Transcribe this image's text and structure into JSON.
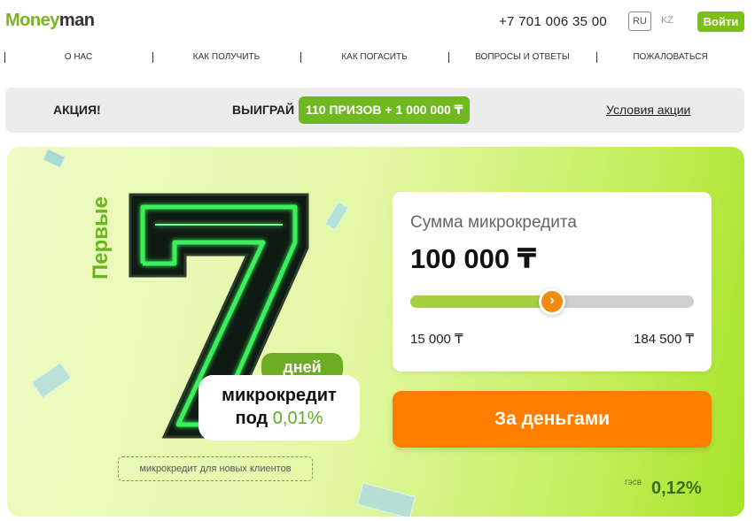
{
  "header": {
    "logo_part1": "Money",
    "logo_part2": "man",
    "phone": "+7 701 006 35 00",
    "lang_ru": "RU",
    "lang_kz": "KZ",
    "login_label": "Войти"
  },
  "nav": {
    "items": [
      {
        "label": "О НАС"
      },
      {
        "label": "КАК ПОЛУЧИТЬ"
      },
      {
        "label": "КАК ПОГАСИТЬ"
      },
      {
        "label": "ВОПРОСЫ И ОТВЕТЫ"
      },
      {
        "label": "ПОЖАЛОВАТЬСЯ"
      }
    ]
  },
  "promo": {
    "label": "АКЦИЯ!",
    "win": "ВЫИГРАЙ",
    "prize": "110 ПРИЗОВ + 1 000 000 ₸",
    "terms_link": "Условия акции"
  },
  "hero": {
    "first": "Первые",
    "seven": "7",
    "days": "дней",
    "credit_line1": "микрокредит",
    "credit_line2_prefix": "под ",
    "credit_rate": "0,01%",
    "new_clients": "микрокредит для новых клиентов",
    "gesv_label": "гэсв",
    "gesv_value": "0,12%"
  },
  "calculator": {
    "label": "Сумма микрокредита",
    "amount": "100 000 ₸",
    "min": "15 000 ₸",
    "max": "184 500 ₸",
    "slider_fraction": 0.5,
    "cta": "За деньгами"
  },
  "colors": {
    "brand_green": "#7cc015",
    "cta_orange": "#ff7e00",
    "neon_green": "#39e35a"
  }
}
